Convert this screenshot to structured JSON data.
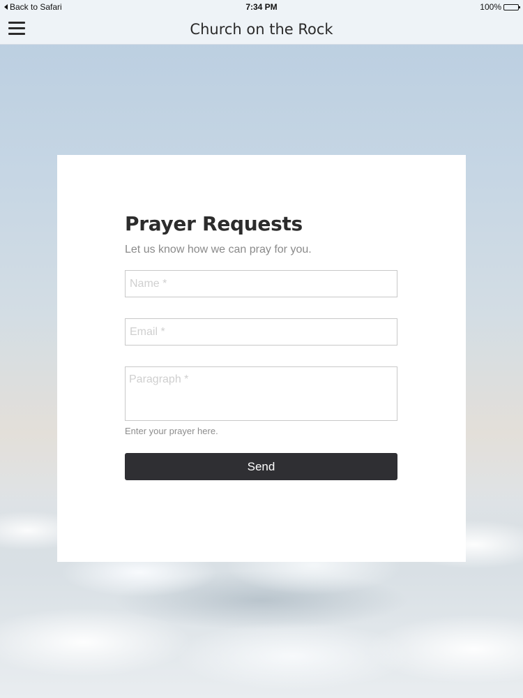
{
  "status_bar": {
    "back_label": "Back to Safari",
    "time": "7:34 PM",
    "battery": "100%"
  },
  "nav": {
    "title": "Church on the Rock",
    "menu_icon": "hamburger-menu-icon"
  },
  "form": {
    "title": "Prayer Requests",
    "subtitle": "Let us know how we can pray for you.",
    "name_placeholder": "Name *",
    "email_placeholder": "Email *",
    "paragraph_placeholder": "Paragraph *",
    "helper": "Enter your prayer here.",
    "send_label": "Send"
  },
  "colors": {
    "button_bg": "#2f2f33",
    "card_bg": "#ffffff"
  }
}
